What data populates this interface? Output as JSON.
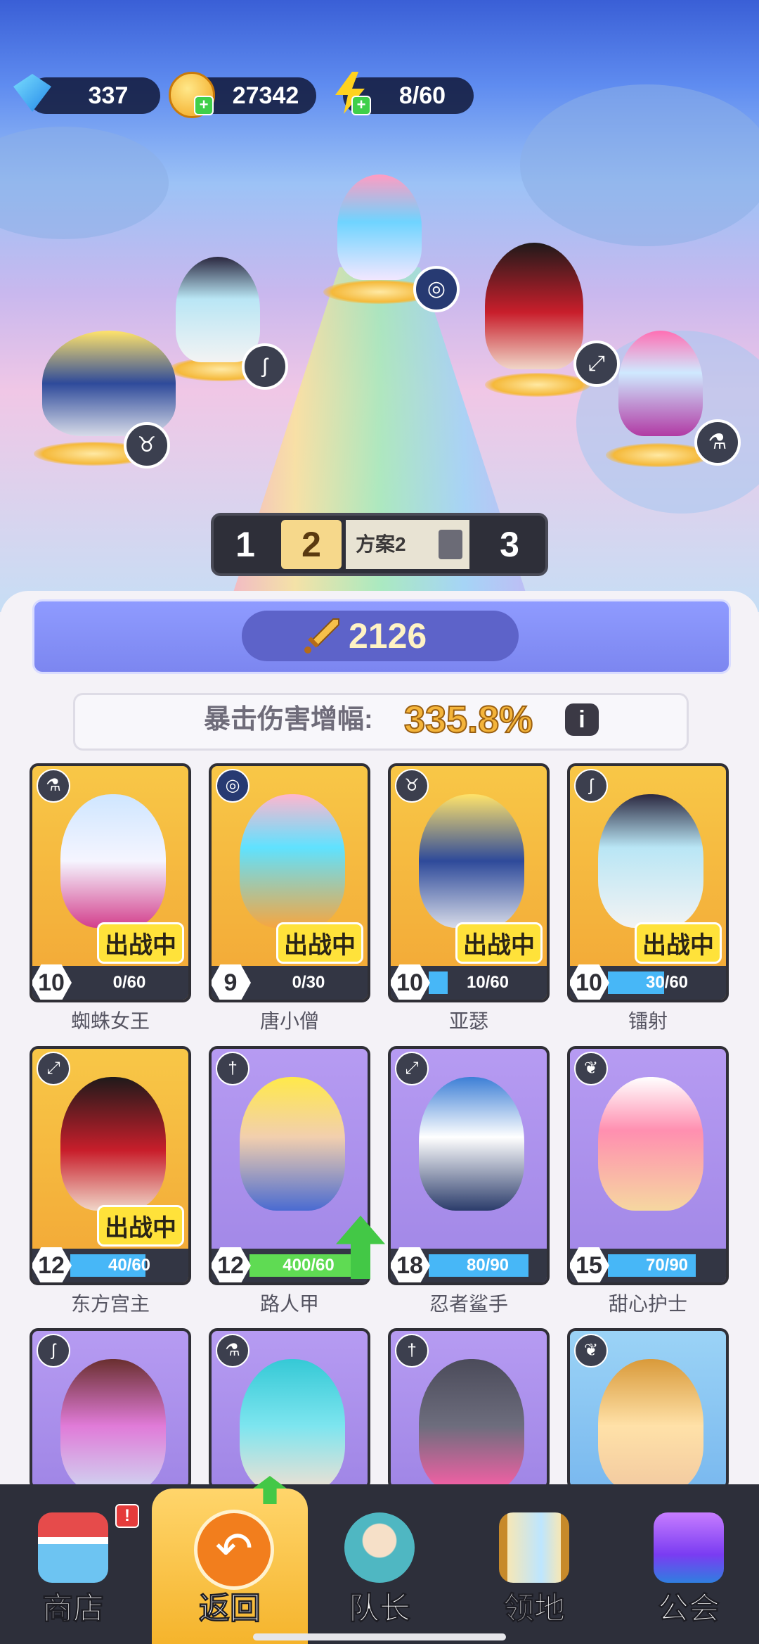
{
  "resources": {
    "gems": "337",
    "coins": "27342",
    "energy": "8/60"
  },
  "loadout": {
    "tab1": "1",
    "tab2": "2",
    "tab2_name": "方案2",
    "tab3": "3",
    "active_tab": 2
  },
  "stats": {
    "power": "2126",
    "crit_label": "暴击伤害增幅:",
    "crit_value": "335.8%"
  },
  "heroes": [
    {
      "name": "蜘蛛女王",
      "level": "10",
      "progress": "0/60",
      "fill": 0,
      "deployed": "出战中",
      "class_icon": "potion-icon"
    },
    {
      "name": "唐小僧",
      "level": "9",
      "progress": "0/30",
      "fill": 0,
      "deployed": "出战中",
      "class_icon": "swirl-icon"
    },
    {
      "name": "亚瑟",
      "level": "10",
      "progress": "10/60",
      "fill": 0.17,
      "deployed": "出战中",
      "class_icon": "horned-helmet-icon"
    },
    {
      "name": "镭射",
      "level": "10",
      "progress": "30/60",
      "fill": 0.5,
      "deployed": "出战中",
      "class_icon": "staff-icon"
    },
    {
      "name": "东方宫主",
      "level": "12",
      "progress": "40/60",
      "fill": 0.67,
      "deployed": "出战中",
      "class_icon": "bow-icon"
    },
    {
      "name": "路人甲",
      "level": "12",
      "progress": "400/60",
      "fill": 1.0,
      "deployed": "",
      "class_icon": "sword-icon"
    },
    {
      "name": "忍者鲨手",
      "level": "18",
      "progress": "80/90",
      "fill": 0.89,
      "deployed": "",
      "class_icon": "bow-icon"
    },
    {
      "name": "甜心护士",
      "level": "15",
      "progress": "70/90",
      "fill": 0.78,
      "deployed": "",
      "class_icon": "wings-icon"
    }
  ],
  "nav": {
    "shop": "商店",
    "back": "返回",
    "captain": "队长",
    "territory": "领地",
    "guild": "公会",
    "shop_badge": "!"
  },
  "colors": {
    "gold_card": "#f8c747",
    "purple_card": "#b69bf2",
    "progress_blue": "#47b7f7",
    "progress_green": "#5fdb53",
    "crit_value": "#f4b43a"
  }
}
